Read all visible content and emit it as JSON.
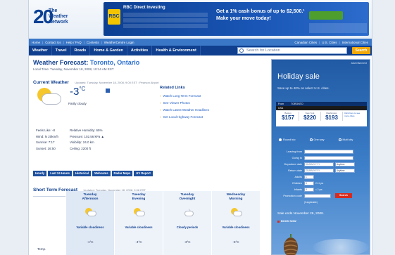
{
  "header": {
    "logo_number": "20",
    "logo_name": "The Weather Network",
    "banner": {
      "brand": "RBC Direct Investing",
      "logo_text": "RBC",
      "offer_line1": "Get a 1% cash bonus of up to $2,500.¹",
      "offer_line2": "Make your move today!"
    }
  },
  "toplinks": {
    "left": [
      "Home",
      "Contact Us",
      "Help / FAQ",
      "Contests",
      "WeatherCentre Login"
    ],
    "right": [
      "Canadian Cities",
      "U.S. Cities",
      "International Cities"
    ]
  },
  "nav": {
    "items": [
      "Weather",
      "Travel",
      "Roads",
      "Home & Garden",
      "Activities",
      "Health & Environment"
    ],
    "search_placeholder": "Search for Location",
    "search_button": "Search"
  },
  "forecast": {
    "title_prefix": "Weather Forecast:",
    "city": "Toronto, Ontario",
    "local_time": "Local Time: Tuesday, November 18, 2008, 10:14 AM EST"
  },
  "current": {
    "title": "Current Weather",
    "updated": "Updated: Tuesday, November 18, 2008, 9:00 EST : Pearson Airport",
    "temp": "-3",
    "unit": "°C",
    "condition": "Partly cloudy",
    "icon": "partly-cloudy-icon",
    "details": [
      {
        "label": "Feels Like:",
        "value": "-8"
      },
      {
        "label": "Wind:",
        "value": "N 20km/h"
      },
      {
        "label": "Sunrise:",
        "value": "7:17"
      },
      {
        "label": "Sunset:",
        "value": "16:50"
      }
    ],
    "details2": [
      {
        "label": "Relative Humidity:",
        "value": "65%"
      },
      {
        "label": "Pressure:",
        "value": "102.56 kPa ▲"
      },
      {
        "label": "Visibility:",
        "value": "24.0 km"
      },
      {
        "label": "Ceiling:",
        "value": "2200 ft"
      }
    ]
  },
  "related": {
    "title": "Related Links",
    "links": [
      "Watch Long Term Forecast",
      "See Viewer Photos",
      "Watch Latest Weather Headlines",
      "Get Local Highway Forecast"
    ]
  },
  "tabs": [
    "Hourly",
    "Last 24 Hours",
    "Historical",
    "Webcams",
    "Radar Maps",
    "UV Report"
  ],
  "short_term": {
    "title": "Short Term Forecast",
    "updated": "Updated: Tuesday, November 18, 2008, 9:08 EST",
    "row_label": "Temp.",
    "periods": [
      {
        "day": "Tuesday",
        "part": "Afternoon",
        "condition": "Variable cloudiness",
        "temp": "-1°C",
        "icon": "partly-cloudy-icon"
      },
      {
        "day": "Tuesday",
        "part": "Evening",
        "condition": "Variable cloudiness",
        "temp": "-4°C",
        "icon": "partly-cloudy-icon"
      },
      {
        "day": "Tuesday",
        "part": "Overnight",
        "condition": "Cloudy periods",
        "temp": "-3°C",
        "icon": "cloudy-night-icon"
      },
      {
        "day": "Wednesday",
        "part": "Morning",
        "condition": "Variable cloudiness",
        "temp": "-5°C",
        "icon": "partly-cloudy-icon"
      }
    ]
  },
  "ad": {
    "tag": "Advertisement",
    "title": "Holiday sale",
    "subtitle": "Save up to 40% on select U.S. cities.",
    "from_label": "From",
    "from_city": "TORONTO",
    "region": "USA",
    "fares": [
      {
        "city": "Boston",
        "price": "$157"
      },
      {
        "city": "New York",
        "price": "$220"
      },
      {
        "city": "Washington",
        "price": "$193"
      }
    ],
    "more_text": "Click here to see more cities",
    "trip_options": [
      "Round trip",
      "One way",
      "Multi city"
    ],
    "form_labels": [
      "Leaving from",
      "Going to",
      "Departure date",
      "Return date",
      "Adults",
      "Children",
      "Infants",
      "Promotion code"
    ],
    "date_placeholder": "DD/MM/YYYY",
    "time_value": "Anytime",
    "count_value": "1",
    "zero_value": "0",
    "children_note": "2-11 yrs",
    "infants_note": "< 2 yrs",
    "promo_note": "(if applicable)",
    "go_button": "Search",
    "ends": "Sale ends November 26, 2008.",
    "book": "BOOK NOW"
  },
  "colors": {
    "navy": "#0f3f8e",
    "link_blue": "#1b5bc0",
    "accent_orange": "#f1a80b",
    "ad_red": "#d72b1f"
  }
}
